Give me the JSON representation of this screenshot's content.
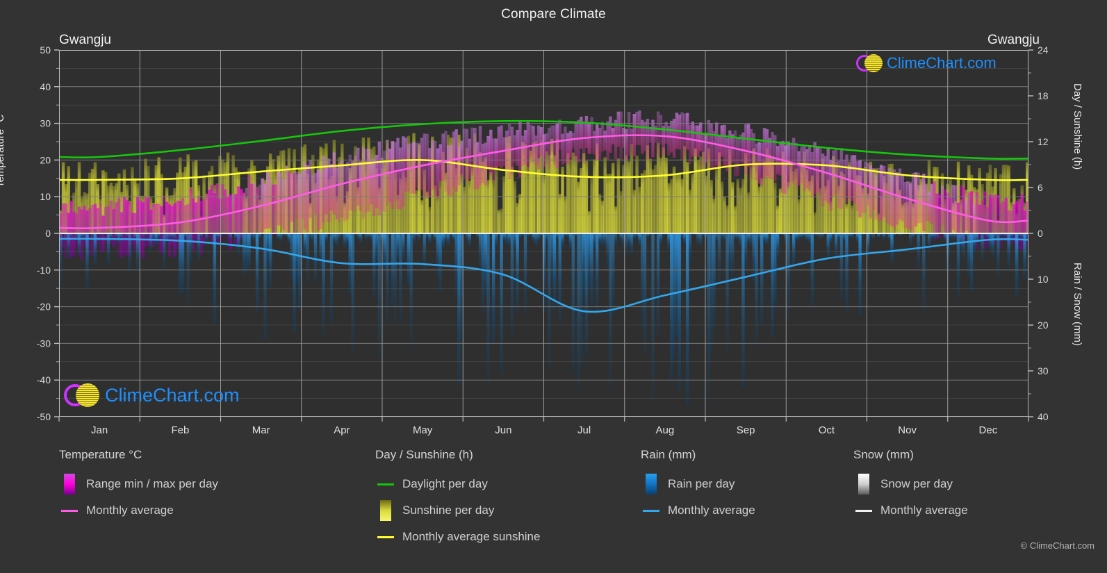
{
  "header": {
    "title": "Compare Climate",
    "city_left": "Gwangju",
    "city_right": "Gwangju"
  },
  "branding": {
    "logo_text": "ClimeChart.com",
    "copyright": "© ClimeChart.com",
    "ring_color": "#cc33ff",
    "ring_color2": "#ff00cc",
    "ball_color": "#e8d60a",
    "text_color": "#1e90ff"
  },
  "axes": {
    "left": {
      "label": "Temperature °C",
      "ticks": [
        50,
        40,
        30,
        20,
        10,
        0,
        -10,
        -20,
        -30,
        -40,
        -50
      ],
      "min": -50,
      "max": 50
    },
    "right_top": {
      "label": "Day / Sunshine (h)",
      "ticks": [
        24,
        18,
        12,
        6,
        0
      ],
      "min": 0,
      "max": 24
    },
    "right_bottom": {
      "label": "Rain / Snow (mm)",
      "ticks": [
        0,
        10,
        20,
        30,
        40
      ],
      "min": 0,
      "max": 40
    },
    "x": {
      "ticks": [
        "Jan",
        "Feb",
        "Mar",
        "Apr",
        "May",
        "Jun",
        "Jul",
        "Aug",
        "Sep",
        "Oct",
        "Nov",
        "Dec"
      ]
    }
  },
  "legend": {
    "columns": [
      {
        "title": "Temperature °C",
        "items": [
          {
            "label": "Range min / max per day",
            "key": "gradient-swatch",
            "color": "#ff00dd"
          },
          {
            "label": "Monthly average",
            "key": "line-swatch",
            "color": "#ff5ce6"
          }
        ]
      },
      {
        "title": "Day / Sunshine (h)",
        "items": [
          {
            "label": "Daylight per day",
            "key": "line-swatch",
            "color": "#16c60c"
          },
          {
            "label": "Sunshine per day",
            "key": "gradient-swatch",
            "color": "#f2f24a"
          },
          {
            "label": "Monthly average sunshine",
            "key": "line-swatch",
            "color": "#ffff33"
          }
        ]
      },
      {
        "title": "Rain (mm)",
        "items": [
          {
            "label": "Rain per day",
            "key": "gradient-swatch",
            "color": "#1f8fe0"
          },
          {
            "label": "Monthly average",
            "key": "line-swatch",
            "color": "#35a6ec"
          }
        ]
      },
      {
        "title": "Snow (mm)",
        "items": [
          {
            "label": "Snow per day",
            "key": "gradient-swatch",
            "color": "#f0f0f0"
          },
          {
            "label": "Monthly average",
            "key": "line-swatch",
            "color": "#f0f0f0"
          }
        ]
      }
    ]
  },
  "chart_data": {
    "type": "line",
    "title": "Compare Climate",
    "subtitle": "Gwangju",
    "location": "Gwangju",
    "xlabel": "",
    "ylabel": "Temperature °C",
    "categories": [
      "Jan",
      "Feb",
      "Mar",
      "Apr",
      "May",
      "Jun",
      "Jul",
      "Aug",
      "Sep",
      "Oct",
      "Nov",
      "Dec"
    ],
    "axis_left": {
      "label": "Temperature °C",
      "min": -50,
      "max": 50,
      "ticks": [
        50,
        40,
        30,
        20,
        10,
        0,
        -10,
        -20,
        -30,
        -40,
        -50
      ]
    },
    "axis_right_upper": {
      "label": "Day / Sunshine (h)",
      "min": 0,
      "max": 24,
      "ticks": [
        0,
        6,
        12,
        18,
        24
      ]
    },
    "axis_right_lower": {
      "label": "Rain / Snow (mm)",
      "min": 0,
      "max": 40,
      "ticks": [
        0,
        10,
        20,
        30,
        40
      ]
    },
    "grid": true,
    "legend_position": "bottom",
    "series": [
      {
        "name": "Monthly average temperature",
        "unit": "°C",
        "color": "#ff5ce6",
        "axis": "left",
        "values": [
          1.5,
          3.0,
          7.5,
          13.5,
          18.5,
          22.5,
          26.0,
          26.5,
          22.5,
          16.5,
          9.5,
          3.5
        ]
      },
      {
        "name": "Daylight per day",
        "unit": "h",
        "color": "#16c60c",
        "axis": "right_upper",
        "values": [
          10.0,
          10.9,
          12.1,
          13.4,
          14.3,
          14.7,
          14.5,
          13.6,
          12.4,
          11.2,
          10.3,
          9.8
        ]
      },
      {
        "name": "Monthly average sunshine",
        "unit": "h",
        "color": "#ffff33",
        "axis": "right_upper",
        "values": [
          7.0,
          7.2,
          8.1,
          8.9,
          9.6,
          8.3,
          7.4,
          7.6,
          9.0,
          8.9,
          7.6,
          7.0
        ]
      },
      {
        "name": "Monthly average rain",
        "unit": "mm",
        "color": "#35a6ec",
        "axis": "right_lower",
        "values": [
          1.2,
          1.6,
          3.3,
          6.5,
          6.7,
          9.0,
          17.0,
          13.5,
          9.5,
          5.5,
          3.5,
          1.4
        ]
      },
      {
        "name": "Monthly average snow",
        "unit": "mm",
        "color": "#f0f0f0",
        "axis": "right_lower",
        "values": [
          0.0,
          0.0,
          0.0,
          0.0,
          0.0,
          0.0,
          0.0,
          0.0,
          0.0,
          0.0,
          0.0,
          0.0
        ]
      }
    ],
    "ranges": [
      {
        "name": "Temperature range min / max per day",
        "unit": "°C",
        "color": "#ff00dd",
        "axis": "left",
        "min": [
          -5.0,
          -4.0,
          -0.5,
          4.5,
          10.5,
          16.5,
          21.5,
          22.0,
          16.5,
          9.0,
          2.5,
          -2.5
        ],
        "max": [
          7.0,
          9.5,
          14.5,
          20.5,
          25.0,
          27.5,
          30.0,
          31.0,
          27.5,
          22.5,
          15.5,
          9.0
        ]
      },
      {
        "name": "Sunshine per day",
        "unit": "h",
        "color": "#e8e83c",
        "axis": "right_upper",
        "min": [
          0,
          0,
          0,
          0,
          0,
          0,
          0,
          0,
          0,
          0,
          0,
          0
        ],
        "max": [
          9.6,
          10.3,
          11.2,
          12.4,
          13.2,
          13.0,
          12.6,
          12.1,
          11.4,
          10.6,
          9.8,
          9.4
        ]
      },
      {
        "name": "Rain per day",
        "unit": "mm",
        "color": "#1f8fe0",
        "axis": "right_lower",
        "min": [
          0,
          0,
          0,
          0,
          0,
          0,
          0,
          0,
          0,
          0,
          0,
          0
        ],
        "max": [
          14,
          18,
          26,
          34,
          33,
          38,
          40,
          40,
          36,
          25,
          20,
          16
        ]
      }
    ]
  }
}
